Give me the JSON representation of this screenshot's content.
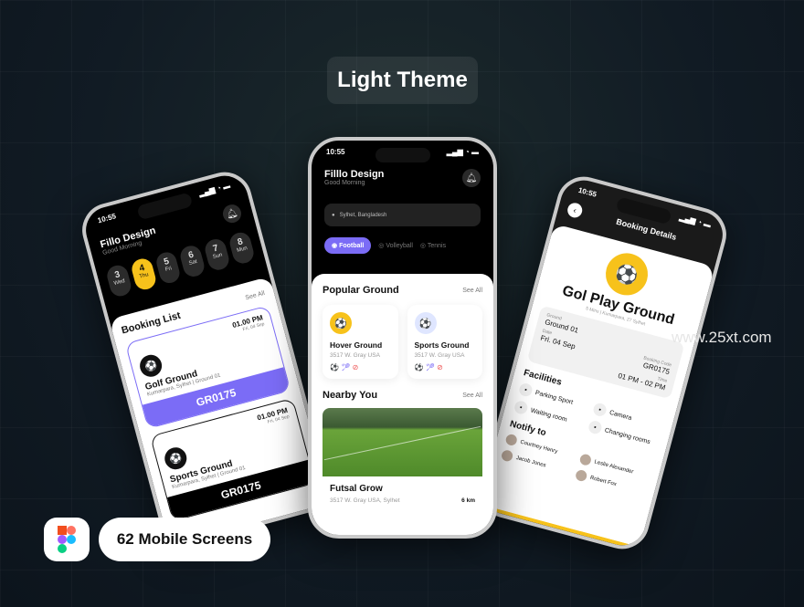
{
  "headline": "Light Theme",
  "watermark": "www.25xt.com",
  "badge": "62 Mobile Screens",
  "colors": {
    "accent": "#7b6cf6",
    "yellow": "#f7c21b",
    "dark": "#000000"
  },
  "left_phone": {
    "time": "10:55",
    "title": "Fillo Design",
    "greeting": "Good Morning",
    "days": [
      {
        "num": "3",
        "day": "Wed"
      },
      {
        "num": "4",
        "day": "Thu"
      },
      {
        "num": "5",
        "day": "Fri"
      },
      {
        "num": "6",
        "day": "Sat"
      },
      {
        "num": "7",
        "day": "Sun"
      },
      {
        "num": "8",
        "day": "Mun"
      }
    ],
    "see_all": "See All",
    "section": "Booking List",
    "bookings": [
      {
        "time": "01.00 PM",
        "date": "Fri, 04 Sep",
        "name": "Golf Ground",
        "location": "Kumarpara, Sylhet | Ground 01",
        "code": "GR0175"
      },
      {
        "time": "01.00 PM",
        "date": "Fri, 04 Sep",
        "name": "Sports Ground",
        "location": "Kumarpara, Sylhet | Ground 01",
        "code": "GR0175"
      }
    ]
  },
  "center_phone": {
    "time": "10:55",
    "title": "Filllo Design",
    "greeting": "Good Morning",
    "location": "Sylhet, Bangladesh",
    "tabs": [
      "Football",
      "Volleyball",
      "Tennis"
    ],
    "popular": {
      "title": "Popular Ground",
      "see_all": "See All",
      "items": [
        {
          "name": "Hover Ground",
          "address": "3517 W. Gray USA"
        },
        {
          "name": "Sports Ground",
          "address": "3517 W. Gray USA"
        }
      ]
    },
    "nearby": {
      "title": "Nearby You",
      "see_all": "See All",
      "name": "Futsal Grow",
      "address": "3517 W. Gray USA, Sylhet",
      "distance": "6 km"
    }
  },
  "right_phone": {
    "time": "10:55",
    "header": "Booking Details",
    "name": "Gol Play Ground",
    "meta": "5 Mins | Kumarpara, 27 Sylhet",
    "ground_label": "Ground",
    "ground": "Ground 01",
    "date_label": "Date",
    "date": "Fri. 04 Sep",
    "code_label": "Booking Code",
    "code": "GR0175",
    "time_label": "Time",
    "time_range": "01 PM - 02 PM",
    "facilities_title": "Facilities",
    "facilities": [
      "Parking Sport",
      "Camera",
      "Waiting room",
      "Changing rooms"
    ],
    "notify_title": "Notify to",
    "people": [
      "Courtney Henry",
      "Leslie Alexander",
      "Jacob Jones",
      "Robert Fox"
    ]
  }
}
